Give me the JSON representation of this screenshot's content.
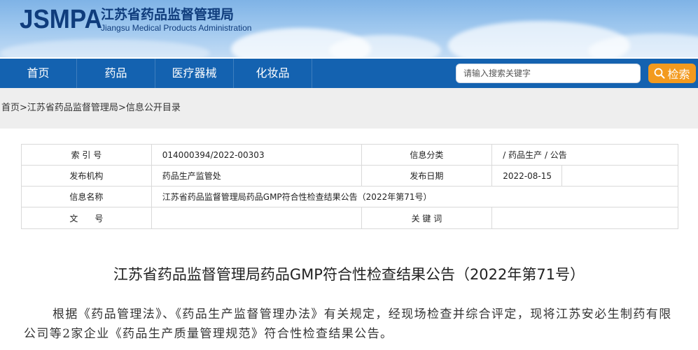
{
  "header": {
    "logo_mark": "JSMPA",
    "org_name_cn": "江苏省药品监督管理局",
    "org_name_en": "Jiangsu Medical Products Administration"
  },
  "nav": {
    "items": [
      {
        "label": "首页"
      },
      {
        "label": "药品"
      },
      {
        "label": "医疗器械"
      },
      {
        "label": "化妆品"
      }
    ],
    "search_placeholder": "请输入搜索关键字",
    "search_button": "检索"
  },
  "breadcrumb": {
    "home": "首页",
    "sep1": ">",
    "bureau": "江苏省药品监督管理局",
    "sep2": ">",
    "catalog": "信息公开目录"
  },
  "info": {
    "index_label": "索 引 号",
    "index_value": "014000394/2022-00303",
    "category_label": "信息分类",
    "category_value": "/  药品生产  /  公告",
    "publisher_label": "发布机构",
    "publisher_value": "药品生产监管处",
    "date_label": "发布日期",
    "date_value": "2022-08-15",
    "name_label": "信息名称",
    "name_value": "江苏省药品监督管理局药品GMP符合性检查结果公告（2022年第71号）",
    "docno_label": "文　　号",
    "docno_value": "",
    "keywords_label": "关 键 词",
    "keywords_value": ""
  },
  "article": {
    "title": "江苏省药品监督管理局药品GMP符合性检查结果公告（2022年第71号）",
    "body": "根据《药品管理法》、《药品生产监督管理办法》有关规定，经现场检查并综合评定，现将江苏安必生制药有限公司等2家企业《药品生产质量管理规范》符合性检查结果公告。"
  },
  "colors": {
    "nav_bg": "#1462b0",
    "search_button_bg": "#f39a1e",
    "logo_color": "#0f3c7c"
  }
}
